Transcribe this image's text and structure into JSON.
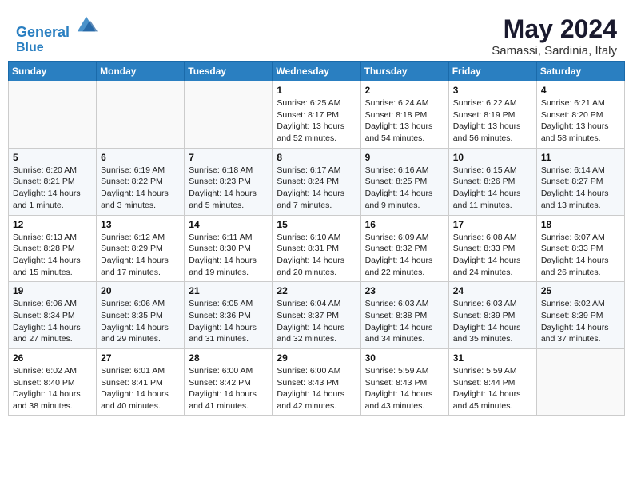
{
  "header": {
    "logo_line1": "General",
    "logo_line2": "Blue",
    "month_year": "May 2024",
    "location": "Samassi, Sardinia, Italy"
  },
  "weekdays": [
    "Sunday",
    "Monday",
    "Tuesday",
    "Wednesday",
    "Thursday",
    "Friday",
    "Saturday"
  ],
  "weeks": [
    [
      {
        "day": "",
        "info": ""
      },
      {
        "day": "",
        "info": ""
      },
      {
        "day": "",
        "info": ""
      },
      {
        "day": "1",
        "info": "Sunrise: 6:25 AM\nSunset: 8:17 PM\nDaylight: 13 hours\nand 52 minutes."
      },
      {
        "day": "2",
        "info": "Sunrise: 6:24 AM\nSunset: 8:18 PM\nDaylight: 13 hours\nand 54 minutes."
      },
      {
        "day": "3",
        "info": "Sunrise: 6:22 AM\nSunset: 8:19 PM\nDaylight: 13 hours\nand 56 minutes."
      },
      {
        "day": "4",
        "info": "Sunrise: 6:21 AM\nSunset: 8:20 PM\nDaylight: 13 hours\nand 58 minutes."
      }
    ],
    [
      {
        "day": "5",
        "info": "Sunrise: 6:20 AM\nSunset: 8:21 PM\nDaylight: 14 hours\nand 1 minute."
      },
      {
        "day": "6",
        "info": "Sunrise: 6:19 AM\nSunset: 8:22 PM\nDaylight: 14 hours\nand 3 minutes."
      },
      {
        "day": "7",
        "info": "Sunrise: 6:18 AM\nSunset: 8:23 PM\nDaylight: 14 hours\nand 5 minutes."
      },
      {
        "day": "8",
        "info": "Sunrise: 6:17 AM\nSunset: 8:24 PM\nDaylight: 14 hours\nand 7 minutes."
      },
      {
        "day": "9",
        "info": "Sunrise: 6:16 AM\nSunset: 8:25 PM\nDaylight: 14 hours\nand 9 minutes."
      },
      {
        "day": "10",
        "info": "Sunrise: 6:15 AM\nSunset: 8:26 PM\nDaylight: 14 hours\nand 11 minutes."
      },
      {
        "day": "11",
        "info": "Sunrise: 6:14 AM\nSunset: 8:27 PM\nDaylight: 14 hours\nand 13 minutes."
      }
    ],
    [
      {
        "day": "12",
        "info": "Sunrise: 6:13 AM\nSunset: 8:28 PM\nDaylight: 14 hours\nand 15 minutes."
      },
      {
        "day": "13",
        "info": "Sunrise: 6:12 AM\nSunset: 8:29 PM\nDaylight: 14 hours\nand 17 minutes."
      },
      {
        "day": "14",
        "info": "Sunrise: 6:11 AM\nSunset: 8:30 PM\nDaylight: 14 hours\nand 19 minutes."
      },
      {
        "day": "15",
        "info": "Sunrise: 6:10 AM\nSunset: 8:31 PM\nDaylight: 14 hours\nand 20 minutes."
      },
      {
        "day": "16",
        "info": "Sunrise: 6:09 AM\nSunset: 8:32 PM\nDaylight: 14 hours\nand 22 minutes."
      },
      {
        "day": "17",
        "info": "Sunrise: 6:08 AM\nSunset: 8:33 PM\nDaylight: 14 hours\nand 24 minutes."
      },
      {
        "day": "18",
        "info": "Sunrise: 6:07 AM\nSunset: 8:33 PM\nDaylight: 14 hours\nand 26 minutes."
      }
    ],
    [
      {
        "day": "19",
        "info": "Sunrise: 6:06 AM\nSunset: 8:34 PM\nDaylight: 14 hours\nand 27 minutes."
      },
      {
        "day": "20",
        "info": "Sunrise: 6:06 AM\nSunset: 8:35 PM\nDaylight: 14 hours\nand 29 minutes."
      },
      {
        "day": "21",
        "info": "Sunrise: 6:05 AM\nSunset: 8:36 PM\nDaylight: 14 hours\nand 31 minutes."
      },
      {
        "day": "22",
        "info": "Sunrise: 6:04 AM\nSunset: 8:37 PM\nDaylight: 14 hours\nand 32 minutes."
      },
      {
        "day": "23",
        "info": "Sunrise: 6:03 AM\nSunset: 8:38 PM\nDaylight: 14 hours\nand 34 minutes."
      },
      {
        "day": "24",
        "info": "Sunrise: 6:03 AM\nSunset: 8:39 PM\nDaylight: 14 hours\nand 35 minutes."
      },
      {
        "day": "25",
        "info": "Sunrise: 6:02 AM\nSunset: 8:39 PM\nDaylight: 14 hours\nand 37 minutes."
      }
    ],
    [
      {
        "day": "26",
        "info": "Sunrise: 6:02 AM\nSunset: 8:40 PM\nDaylight: 14 hours\nand 38 minutes."
      },
      {
        "day": "27",
        "info": "Sunrise: 6:01 AM\nSunset: 8:41 PM\nDaylight: 14 hours\nand 40 minutes."
      },
      {
        "day": "28",
        "info": "Sunrise: 6:00 AM\nSunset: 8:42 PM\nDaylight: 14 hours\nand 41 minutes."
      },
      {
        "day": "29",
        "info": "Sunrise: 6:00 AM\nSunset: 8:43 PM\nDaylight: 14 hours\nand 42 minutes."
      },
      {
        "day": "30",
        "info": "Sunrise: 5:59 AM\nSunset: 8:43 PM\nDaylight: 14 hours\nand 43 minutes."
      },
      {
        "day": "31",
        "info": "Sunrise: 5:59 AM\nSunset: 8:44 PM\nDaylight: 14 hours\nand 45 minutes."
      },
      {
        "day": "",
        "info": ""
      }
    ]
  ]
}
